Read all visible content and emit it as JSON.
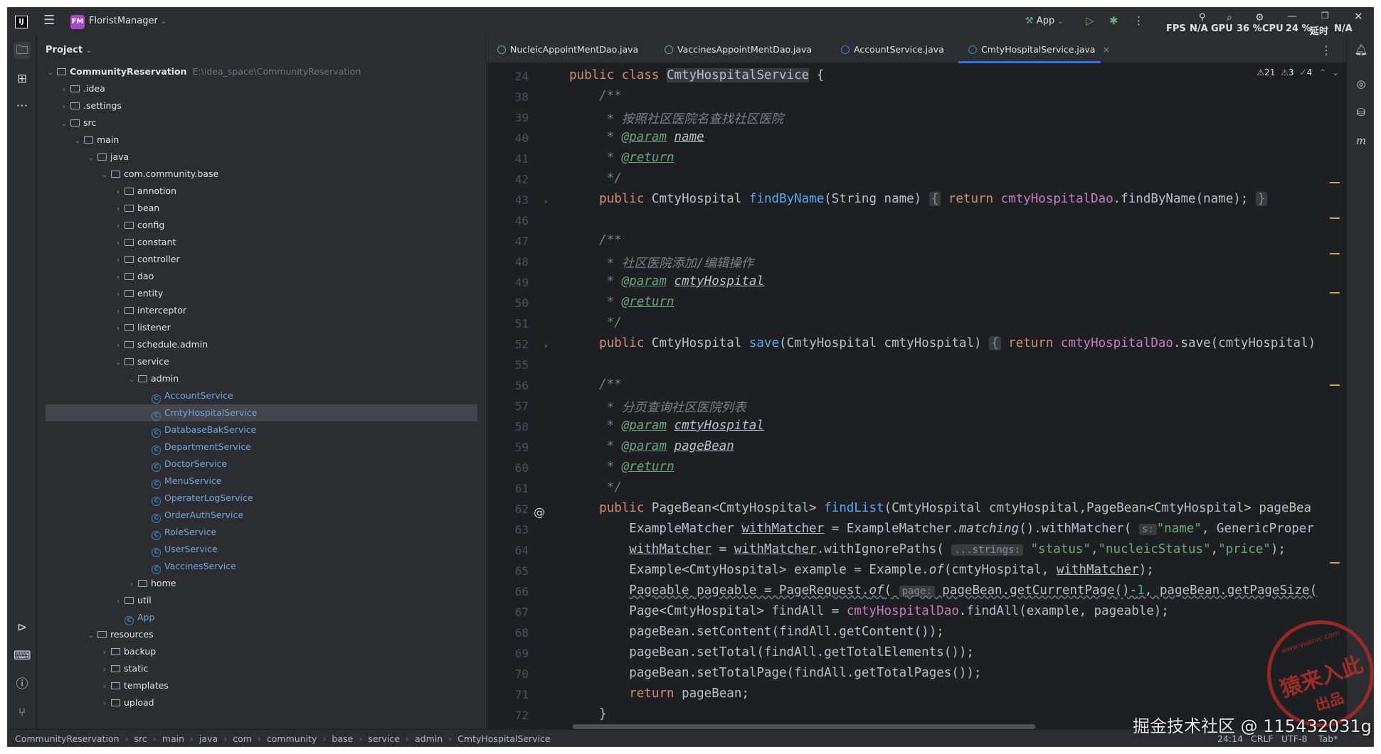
{
  "titlebar": {
    "project_badge": "FM",
    "project_name": "FloristManager",
    "run_config": "App",
    "perf": [
      "FPS",
      "N/A",
      "GPU",
      "36 %",
      "CPU",
      "24 %",
      "延时",
      "N/A"
    ]
  },
  "project_panel": {
    "title": "Project",
    "tree": [
      {
        "label": "CommunityReservation",
        "path": "E:\\idea_space\\CommunityReservation",
        "depth": 0,
        "type": "module",
        "expanded": true
      },
      {
        "label": ".idea",
        "depth": 1,
        "type": "folder",
        "expanded": false
      },
      {
        "label": ".settings",
        "depth": 1,
        "type": "folder",
        "expanded": false
      },
      {
        "label": "src",
        "depth": 1,
        "type": "folder",
        "expanded": true
      },
      {
        "label": "main",
        "depth": 2,
        "type": "folder",
        "expanded": true
      },
      {
        "label": "java",
        "depth": 3,
        "type": "folder",
        "expanded": true
      },
      {
        "label": "com.community.base",
        "depth": 4,
        "type": "package",
        "expanded": true
      },
      {
        "label": "annotion",
        "depth": 5,
        "type": "package",
        "expanded": false
      },
      {
        "label": "bean",
        "depth": 5,
        "type": "package",
        "expanded": false
      },
      {
        "label": "config",
        "depth": 5,
        "type": "package",
        "expanded": false
      },
      {
        "label": "constant",
        "depth": 5,
        "type": "package",
        "expanded": false
      },
      {
        "label": "controller",
        "depth": 5,
        "type": "package",
        "expanded": false
      },
      {
        "label": "dao",
        "depth": 5,
        "type": "package",
        "expanded": false
      },
      {
        "label": "entity",
        "depth": 5,
        "type": "package",
        "expanded": false
      },
      {
        "label": "interceptor",
        "depth": 5,
        "type": "package",
        "expanded": false
      },
      {
        "label": "listener",
        "depth": 5,
        "type": "package",
        "expanded": false
      },
      {
        "label": "schedule.admin",
        "depth": 5,
        "type": "package",
        "expanded": false
      },
      {
        "label": "service",
        "depth": 5,
        "type": "package",
        "expanded": true
      },
      {
        "label": "admin",
        "depth": 6,
        "type": "package",
        "expanded": true
      },
      {
        "label": "AccountService",
        "depth": 7,
        "type": "class"
      },
      {
        "label": "CmtyHospitalService",
        "depth": 7,
        "type": "class",
        "selected": true
      },
      {
        "label": "DatabaseBakService",
        "depth": 7,
        "type": "class"
      },
      {
        "label": "DepartmentService",
        "depth": 7,
        "type": "class"
      },
      {
        "label": "DoctorService",
        "depth": 7,
        "type": "class"
      },
      {
        "label": "MenuService",
        "depth": 7,
        "type": "class"
      },
      {
        "label": "OperaterLogService",
        "depth": 7,
        "type": "class"
      },
      {
        "label": "OrderAuthService",
        "depth": 7,
        "type": "class"
      },
      {
        "label": "RoleService",
        "depth": 7,
        "type": "class"
      },
      {
        "label": "UserService",
        "depth": 7,
        "type": "class"
      },
      {
        "label": "VaccinesService",
        "depth": 7,
        "type": "class"
      },
      {
        "label": "home",
        "depth": 6,
        "type": "package",
        "expanded": false
      },
      {
        "label": "util",
        "depth": 5,
        "type": "package",
        "expanded": false
      },
      {
        "label": "App",
        "depth": 5,
        "type": "class"
      },
      {
        "label": "resources",
        "depth": 3,
        "type": "folder",
        "expanded": true
      },
      {
        "label": "backup",
        "depth": 4,
        "type": "folder",
        "expanded": false
      },
      {
        "label": "static",
        "depth": 4,
        "type": "folder",
        "expanded": false
      },
      {
        "label": "templates",
        "depth": 4,
        "type": "folder",
        "expanded": false
      },
      {
        "label": "upload",
        "depth": 4,
        "type": "folder",
        "expanded": false
      }
    ]
  },
  "tabs": [
    {
      "label": "NucleicAppointMentDao.java",
      "active": false
    },
    {
      "label": "VaccinesAppointMentDao.java",
      "active": false
    },
    {
      "label": "AccountService.java",
      "active": false
    },
    {
      "label": "CmtyHospitalService.java",
      "active": true
    }
  ],
  "inspections": {
    "warnings": "21",
    "weak_warnings": "3",
    "ok": "4"
  },
  "line_numbers": [
    "24",
    "38",
    "39",
    "40",
    "41",
    "42",
    "43",
    "46",
    "47",
    "48",
    "49",
    "50",
    "51",
    "52",
    "55",
    "56",
    "57",
    "58",
    "59",
    "60",
    "61",
    "62",
    "63",
    "64",
    "65",
    "66",
    "67",
    "68",
    "69",
    "70",
    "71",
    "72"
  ],
  "breadcrumb": [
    "CommunityReservation",
    "src",
    "main",
    "java",
    "com",
    "community",
    "base",
    "service",
    "admin",
    "CmtyHospitalService"
  ],
  "status": {
    "position": "24:14",
    "line_sep": "CRLF",
    "encoding": "UTF-8",
    "indent": "Tab*"
  },
  "stamp": {
    "line1": "猿来入此",
    "line2": "出品",
    "url": "www.yuanrc.com"
  },
  "watermark": "掘金技术社区 @ 115432031g",
  "colors": {
    "accent": "#3574f0",
    "keyword": "#cf8e6d",
    "function": "#56a8f5",
    "field": "#c77dbb",
    "string": "#6aab73",
    "comment": "#7a7e85"
  }
}
